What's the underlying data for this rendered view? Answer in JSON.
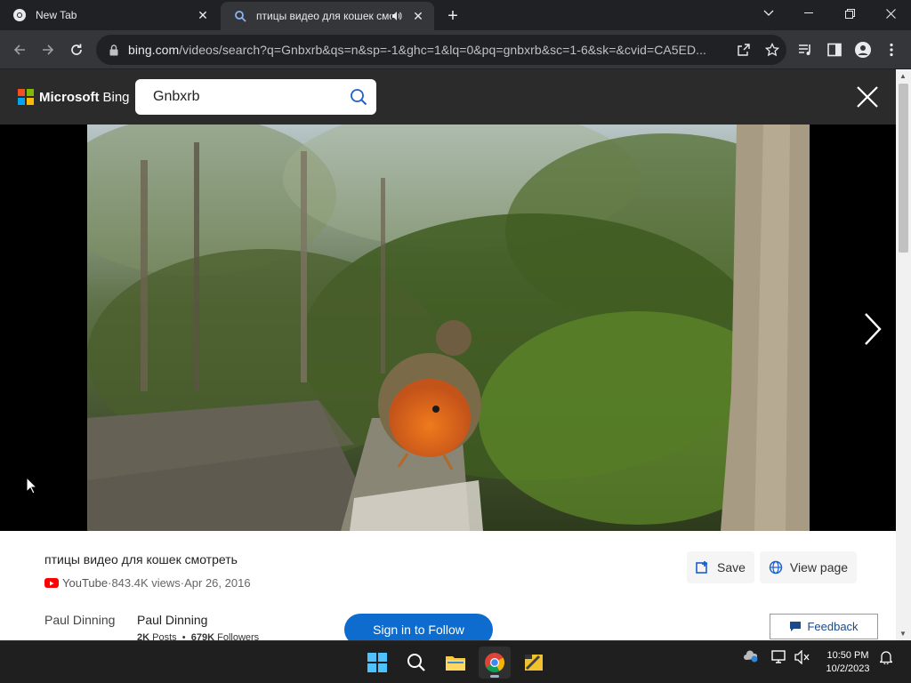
{
  "tabs": [
    {
      "title": "New Tab"
    },
    {
      "title": "птицы видео для кошек смотреть"
    }
  ],
  "address": {
    "host": "bing.com",
    "path": "/videos/search?q=Gnbxrb&qs=n&sp=-1&ghc=1&lq=0&pq=gnbxrb&sc=1-6&sk=&cvid=CA5ED..."
  },
  "bing": {
    "logo_text_bold": "Microsoft",
    "logo_text": "Bing",
    "query": "Gnbxrb",
    "colors": {
      "red": "#f25022",
      "green": "#7fba00",
      "blue": "#00a4ef",
      "yellow": "#ffb900"
    }
  },
  "video": {
    "title": "птицы видео для кошек смотреть",
    "source": "YouTube",
    "views": "843.4K views",
    "date": "Apr 26, 2016",
    "separator": " · ",
    "actions": {
      "save": "Save",
      "view_page": "View page"
    },
    "author": {
      "avatar_alt": "Paul Dinning",
      "name": "Paul Dinning",
      "posts_value": "2K",
      "posts_label": "Posts",
      "followers_value": "679K",
      "followers_label": "Followers",
      "dot": "•"
    },
    "follow_label": "Sign in to Follow",
    "feedback_label": "Feedback"
  },
  "taskbar": {
    "time": "10:50 PM",
    "date": "10/2/2023"
  }
}
